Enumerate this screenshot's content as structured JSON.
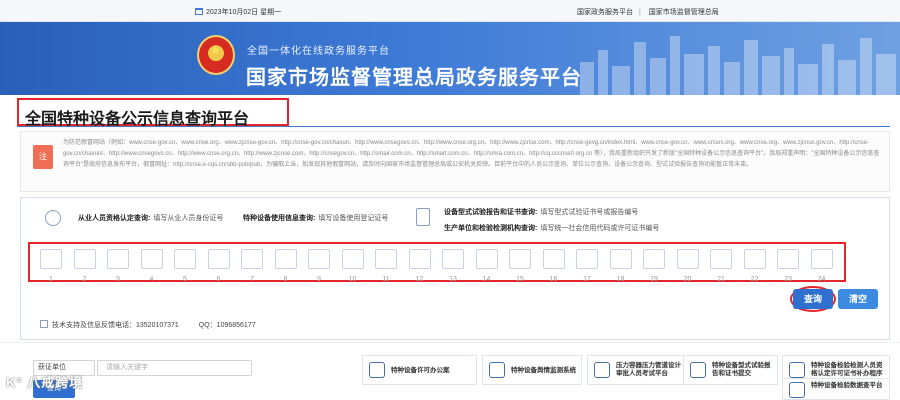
{
  "topbar": {
    "date": "2023年10月02日 星期一",
    "links": [
      "国家政务服务平台",
      "国家市场监督管理总局"
    ],
    "separator": "|"
  },
  "banner": {
    "subtitle": "全国一体化在线政务服务平台",
    "title": "国家市场监督管理总局政务服务平台"
  },
  "page_title": "全国特种设备公示信息查询平台",
  "notice": {
    "icon_text": "注",
    "text": "为防范假冒网站（例如：www.cnse-gov.cn、www.cnse.org、www.zjcnse-gov.cn、http://cnse-gov.cn/chaxun、http://www.cnsegovs.cn、http://www.cnse.org.cn、http://www.zjcnse.com、http://cnse-gevg.cn/index.html、www.cnse-gov.cn、www.cnses.org、www.cnse.org、www.zjcnse.gov.cn、http://cnse-gov.cn/chaxun/、http://www.cnsegovs.cn、http://www.cnse.org.cn、http://www.zjcnse.com、http://cnsegov.cn、http://smair.com.cn、http://smart.com.cn、http://smra.com.cn、http://cq.cccnse0.org.cn 等），我局重新组织开发了新版\"全国特种设备公示信息查询平台\"。我局郑重声明：\"全国特种设备公示信息查询平台\"是政府信息发布平台，假冒网址：http://cnse.e-cqs.cn/sbb-pub/pub，为骗取上当，如发现其他假冒网站，请及时向国家市场监督管理总局或公安机关反映。目前平台中的人员公示查询、单位公示查询、设备公示查询、型式试验报告查询功能暂正常未束。"
  },
  "queries": [
    {
      "label": "从业人员资格认定查询:",
      "hint": "填写从业人员身份证号"
    },
    {
      "label": "特种设备使用信息查询:",
      "hint": "填写设备使用登记证号"
    },
    {
      "label": "设备型式试验报告和证书查询:",
      "hint": "填写型式试验证书号或报告编号"
    },
    {
      "label": "生产单位和检验检测机构查询:",
      "hint": "填写统一社会信用代码或许可证书编号"
    }
  ],
  "digits": [
    "1",
    "2",
    "3",
    "4",
    "5",
    "6",
    "7",
    "8",
    "9",
    "10",
    "11",
    "12",
    "13",
    "14",
    "15",
    "16",
    "17",
    "18",
    "19",
    "20",
    "21",
    "22",
    "23",
    "24"
  ],
  "buttons": {
    "search": "查询",
    "clear": "清空"
  },
  "contact": {
    "phone": "技术支持及信息反馈电话：13520107371",
    "qq": "QQ：1096856177"
  },
  "bottom": {
    "select_value": "获证单位",
    "input_placeholder": "请输入关键字",
    "button": "查询",
    "cards": [
      "特种设备许可办公案",
      "特种设备舆情监测系统",
      "压力容器压力管道设计审批人员考试平台",
      "特种设备型式试验报告和证书提交",
      "特种设备检验检测人员资格认定许可证书补办程序",
      "特种设备检验数据查平台"
    ]
  },
  "watermark": "K° 八戒跨境",
  "colors": {
    "brand_blue": "#2f6fcf",
    "highlight_red": "#e4262c",
    "banner_start": "#2a5fb9",
    "banner_end": "#6fa0e2"
  }
}
